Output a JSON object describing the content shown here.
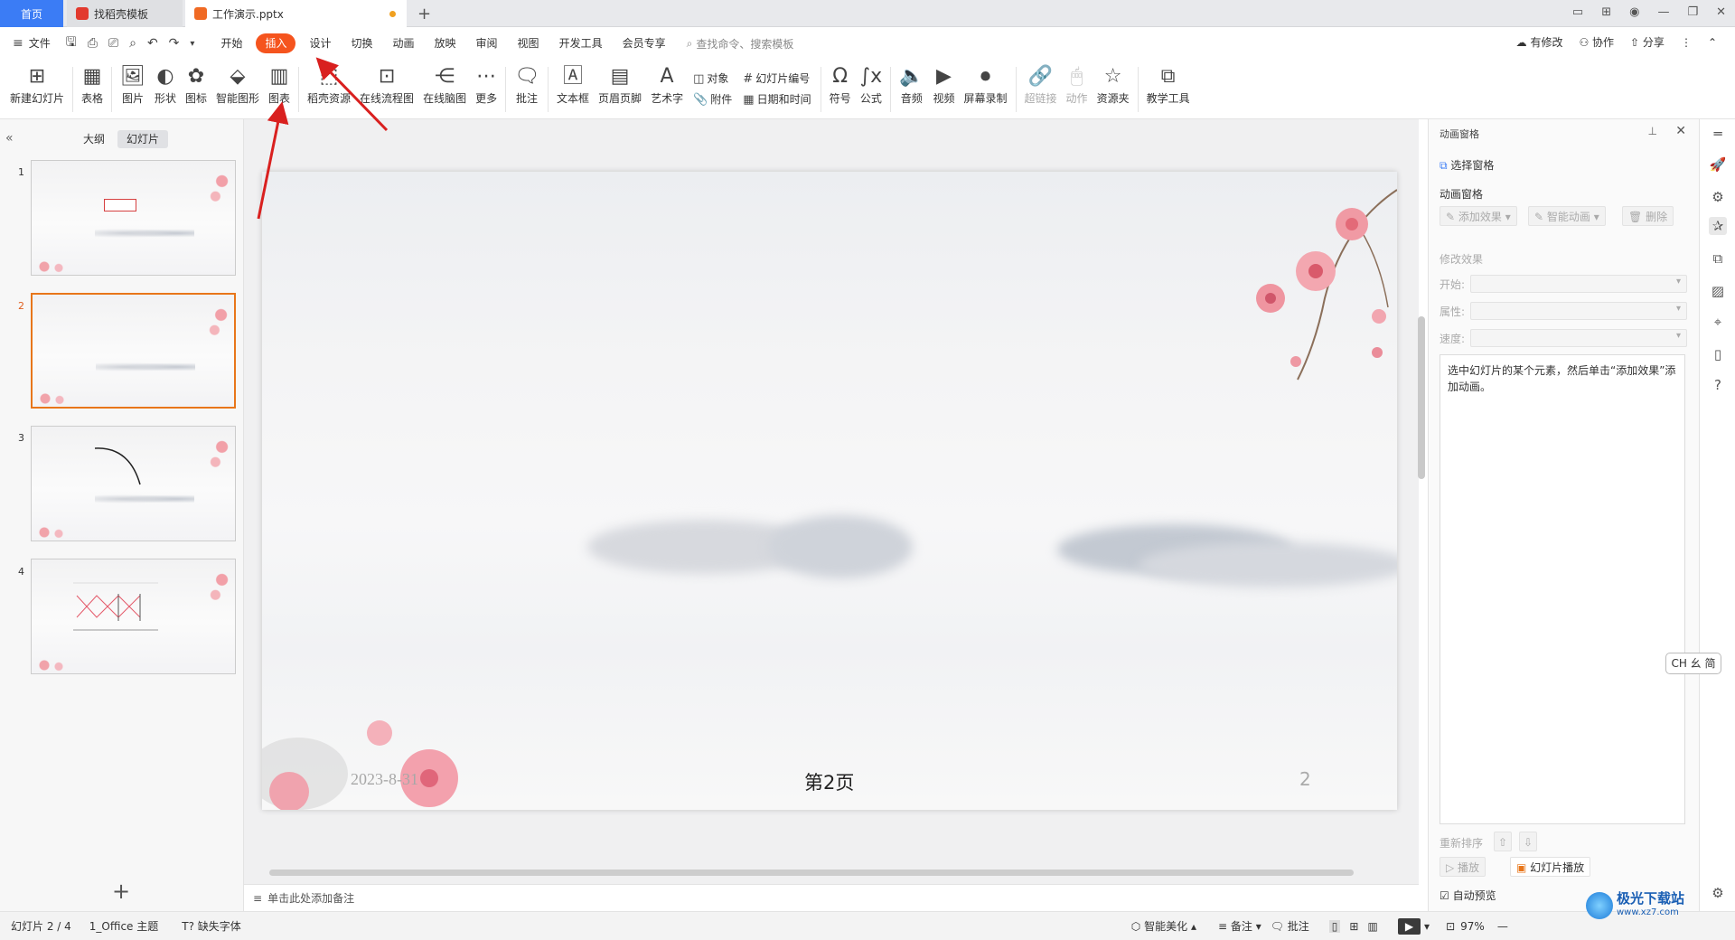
{
  "titlebar": {
    "tabs": [
      {
        "label": "首页"
      },
      {
        "label": "找稻壳模板"
      },
      {
        "label": "工作演示.pptx"
      }
    ]
  },
  "menubar": {
    "file": "文件",
    "items": [
      "开始",
      "插入",
      "设计",
      "切换",
      "动画",
      "放映",
      "审阅",
      "视图",
      "开发工具",
      "会员专享"
    ],
    "active": "插入",
    "search_placeholder": "查找命令、搜索模板",
    "right": [
      "有修改",
      "协作",
      "分享"
    ]
  },
  "ribbon": {
    "new_slide": "新建幻灯片",
    "table": "表格",
    "picture": "图片",
    "shape": "形状",
    "icon": "图标",
    "smart_art": "智能图形",
    "chart": "图表",
    "straw_resources": "稻壳资源",
    "online_flowchart": "在线流程图",
    "online_mindmap": "在线脑图",
    "more": "更多",
    "comment": "批注",
    "textbox": "文本框",
    "header_footer": "页眉页脚",
    "wordart": "艺术字",
    "object": "对象",
    "attachment": "附件",
    "slide_number": "幻灯片编号",
    "date_time": "日期和时间",
    "symbol": "符号",
    "formula": "公式",
    "audio": "音频",
    "video": "视频",
    "screen_record": "屏幕录制",
    "hyperlink": "超链接",
    "action": "动作",
    "resource_folder": "资源夹",
    "teaching_tools": "教学工具"
  },
  "left_pane": {
    "tabs": [
      "大纲",
      "幻灯片"
    ],
    "selected_tab": "幻灯片",
    "slides": [
      {
        "num": "1"
      },
      {
        "num": "2"
      },
      {
        "num": "3"
      },
      {
        "num": "4"
      }
    ],
    "current": "2"
  },
  "slide": {
    "date": "2023-8-31",
    "title": "第2页",
    "page_num": "2"
  },
  "notes_placeholder": "单击此处添加备注",
  "right_pane": {
    "title": "动画窗格",
    "select_pane": "选择窗格",
    "anim_pane": "动画窗格",
    "add_effect": "添加效果",
    "smart_anim": "智能动画",
    "delete": "删除",
    "modify": "修改效果",
    "start": "开始:",
    "property": "属性:",
    "speed": "速度:",
    "hint": "选中幻灯片的某个元素，然后单击“添加效果”添加动画。",
    "reorder": "重新排序",
    "play": "播放",
    "slide_play": "幻灯片播放",
    "auto_preview": "自动预览"
  },
  "ime": "CH ⺓ 简",
  "status": {
    "slide_pos": "幻灯片 2 / 4",
    "theme": "1_Office 主题",
    "missing_font": "缺失字体",
    "smart_beautify": "智能美化",
    "notes": "备注",
    "comment": "批注",
    "zoom": "97%"
  },
  "watermark": {
    "text": "极光下载站",
    "url": "www.xz7.com"
  },
  "colors": {
    "accent": "#f5541e",
    "home_tab": "#3b7cf5",
    "selection": "#e8761a",
    "arrow": "#d9201f"
  }
}
